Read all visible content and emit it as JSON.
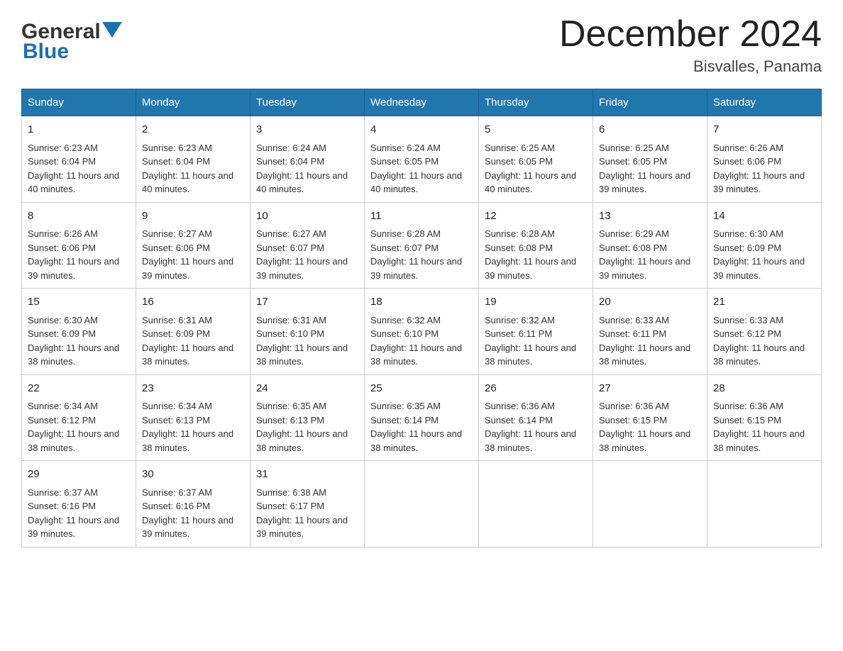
{
  "header": {
    "logo_general": "General",
    "logo_blue": "Blue",
    "month_title": "December 2024",
    "location": "Bisvalles, Panama"
  },
  "days_of_week": [
    "Sunday",
    "Monday",
    "Tuesday",
    "Wednesday",
    "Thursday",
    "Friday",
    "Saturday"
  ],
  "weeks": [
    [
      {
        "day": "1",
        "sunrise": "6:23 AM",
        "sunset": "6:04 PM",
        "daylight": "11 hours and 40 minutes."
      },
      {
        "day": "2",
        "sunrise": "6:23 AM",
        "sunset": "6:04 PM",
        "daylight": "11 hours and 40 minutes."
      },
      {
        "day": "3",
        "sunrise": "6:24 AM",
        "sunset": "6:04 PM",
        "daylight": "11 hours and 40 minutes."
      },
      {
        "day": "4",
        "sunrise": "6:24 AM",
        "sunset": "6:05 PM",
        "daylight": "11 hours and 40 minutes."
      },
      {
        "day": "5",
        "sunrise": "6:25 AM",
        "sunset": "6:05 PM",
        "daylight": "11 hours and 40 minutes."
      },
      {
        "day": "6",
        "sunrise": "6:25 AM",
        "sunset": "6:05 PM",
        "daylight": "11 hours and 39 minutes."
      },
      {
        "day": "7",
        "sunrise": "6:26 AM",
        "sunset": "6:06 PM",
        "daylight": "11 hours and 39 minutes."
      }
    ],
    [
      {
        "day": "8",
        "sunrise": "6:26 AM",
        "sunset": "6:06 PM",
        "daylight": "11 hours and 39 minutes."
      },
      {
        "day": "9",
        "sunrise": "6:27 AM",
        "sunset": "6:06 PM",
        "daylight": "11 hours and 39 minutes."
      },
      {
        "day": "10",
        "sunrise": "6:27 AM",
        "sunset": "6:07 PM",
        "daylight": "11 hours and 39 minutes."
      },
      {
        "day": "11",
        "sunrise": "6:28 AM",
        "sunset": "6:07 PM",
        "daylight": "11 hours and 39 minutes."
      },
      {
        "day": "12",
        "sunrise": "6:28 AM",
        "sunset": "6:08 PM",
        "daylight": "11 hours and 39 minutes."
      },
      {
        "day": "13",
        "sunrise": "6:29 AM",
        "sunset": "6:08 PM",
        "daylight": "11 hours and 39 minutes."
      },
      {
        "day": "14",
        "sunrise": "6:30 AM",
        "sunset": "6:09 PM",
        "daylight": "11 hours and 39 minutes."
      }
    ],
    [
      {
        "day": "15",
        "sunrise": "6:30 AM",
        "sunset": "6:09 PM",
        "daylight": "11 hours and 38 minutes."
      },
      {
        "day": "16",
        "sunrise": "6:31 AM",
        "sunset": "6:09 PM",
        "daylight": "11 hours and 38 minutes."
      },
      {
        "day": "17",
        "sunrise": "6:31 AM",
        "sunset": "6:10 PM",
        "daylight": "11 hours and 38 minutes."
      },
      {
        "day": "18",
        "sunrise": "6:32 AM",
        "sunset": "6:10 PM",
        "daylight": "11 hours and 38 minutes."
      },
      {
        "day": "19",
        "sunrise": "6:32 AM",
        "sunset": "6:11 PM",
        "daylight": "11 hours and 38 minutes."
      },
      {
        "day": "20",
        "sunrise": "6:33 AM",
        "sunset": "6:11 PM",
        "daylight": "11 hours and 38 minutes."
      },
      {
        "day": "21",
        "sunrise": "6:33 AM",
        "sunset": "6:12 PM",
        "daylight": "11 hours and 38 minutes."
      }
    ],
    [
      {
        "day": "22",
        "sunrise": "6:34 AM",
        "sunset": "6:12 PM",
        "daylight": "11 hours and 38 minutes."
      },
      {
        "day": "23",
        "sunrise": "6:34 AM",
        "sunset": "6:13 PM",
        "daylight": "11 hours and 38 minutes."
      },
      {
        "day": "24",
        "sunrise": "6:35 AM",
        "sunset": "6:13 PM",
        "daylight": "11 hours and 38 minutes."
      },
      {
        "day": "25",
        "sunrise": "6:35 AM",
        "sunset": "6:14 PM",
        "daylight": "11 hours and 38 minutes."
      },
      {
        "day": "26",
        "sunrise": "6:36 AM",
        "sunset": "6:14 PM",
        "daylight": "11 hours and 38 minutes."
      },
      {
        "day": "27",
        "sunrise": "6:36 AM",
        "sunset": "6:15 PM",
        "daylight": "11 hours and 38 minutes."
      },
      {
        "day": "28",
        "sunrise": "6:36 AM",
        "sunset": "6:15 PM",
        "daylight": "11 hours and 38 minutes."
      }
    ],
    [
      {
        "day": "29",
        "sunrise": "6:37 AM",
        "sunset": "6:16 PM",
        "daylight": "11 hours and 39 minutes."
      },
      {
        "day": "30",
        "sunrise": "6:37 AM",
        "sunset": "6:16 PM",
        "daylight": "11 hours and 39 minutes."
      },
      {
        "day": "31",
        "sunrise": "6:38 AM",
        "sunset": "6:17 PM",
        "daylight": "11 hours and 39 minutes."
      },
      null,
      null,
      null,
      null
    ]
  ],
  "labels": {
    "sunrise": "Sunrise:",
    "sunset": "Sunset:",
    "daylight": "Daylight:"
  }
}
